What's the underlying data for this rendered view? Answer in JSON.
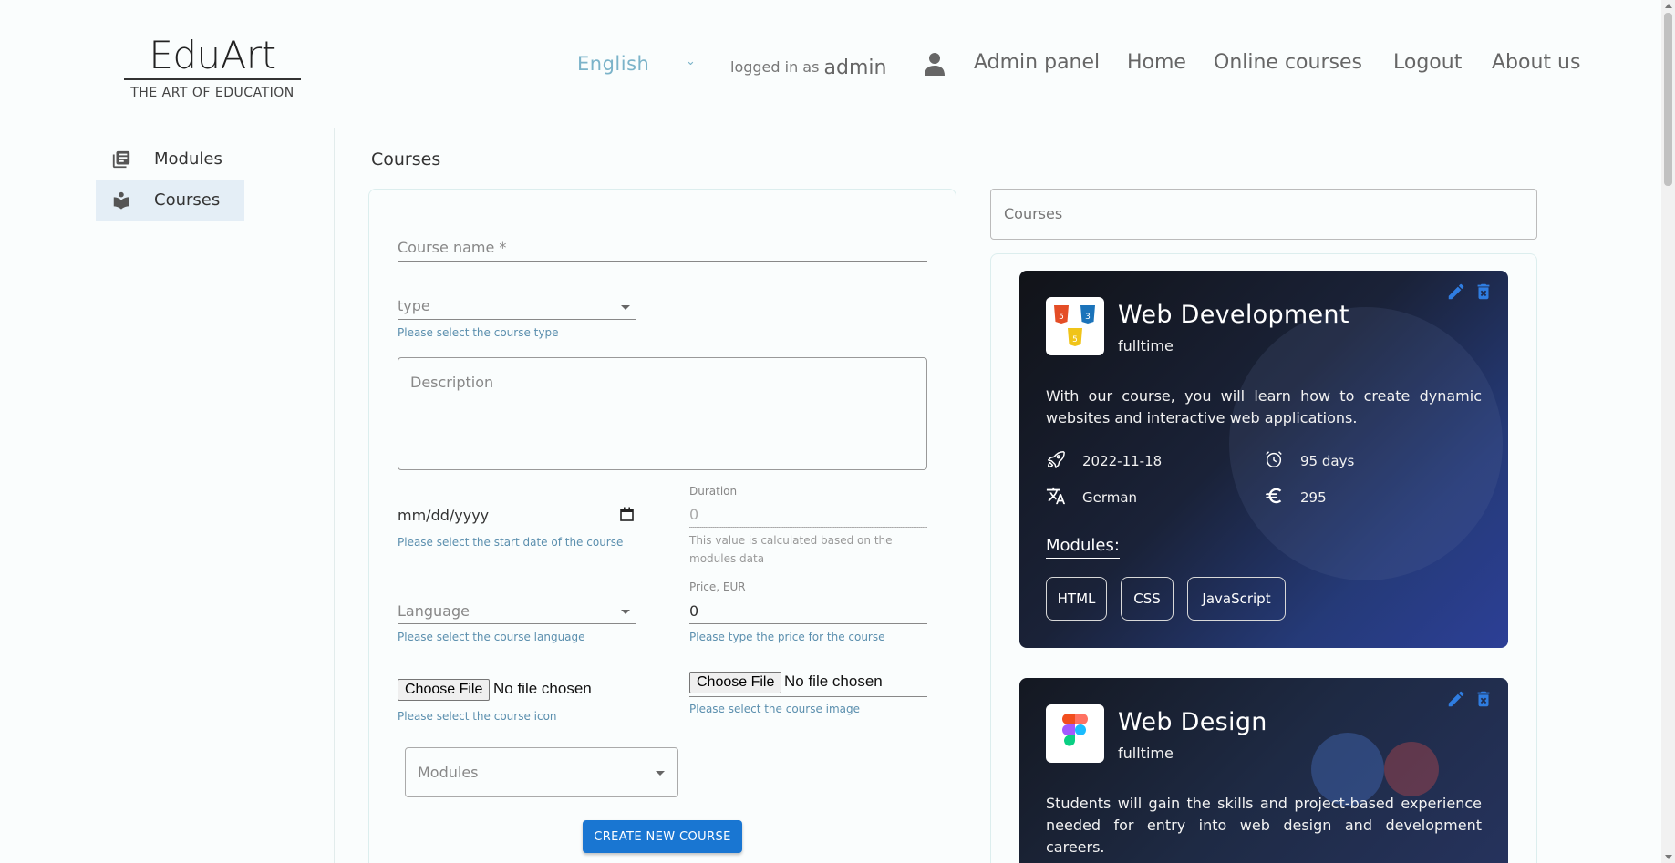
{
  "logo": {
    "title": "EduArt",
    "subtitle": "THE ART OF EDUCATION"
  },
  "header": {
    "language": "English",
    "logged_prefix": "logged in as",
    "username": "admin",
    "nav": [
      "Admin panel",
      "Home",
      "Online courses",
      "Logout",
      "About us"
    ]
  },
  "sidebar": {
    "items": [
      {
        "label": "Modules",
        "icon": "library-books-icon",
        "active": false
      },
      {
        "label": "Courses",
        "icon": "local-library-icon",
        "active": true
      }
    ]
  },
  "page": {
    "title": "Courses"
  },
  "form": {
    "course_name_label": "Course name *",
    "type_label": "type",
    "type_helper": "Please select the course type",
    "description_placeholder": "Description",
    "date_placeholder": "mm/dd/yyyy",
    "date_helper": "Please select the start date of the course",
    "duration_label": "Duration",
    "duration_value": "0",
    "duration_helper_1": "This value is calculated based on the",
    "duration_helper_2": "modules data",
    "language_label": "Language",
    "language_helper": "Please select the course language",
    "price_label": "Price, EUR",
    "price_value": "0",
    "price_helper": "Please type the price for the course",
    "choose_file": "Choose File",
    "no_file": "No file chosen",
    "icon_helper": "Please select the course icon",
    "image_helper": "Please select the course image",
    "modules_label": "Modules",
    "create_button": "CREATE NEW COURSE"
  },
  "search": {
    "placeholder": "Courses"
  },
  "courses": [
    {
      "title": "Web Development",
      "type": "fulltime",
      "description": "With our course, you will learn how to create dynamic websites and interactive web applications.",
      "start_date": "2022-11-18",
      "duration": "95 days",
      "language": "German",
      "price": "295",
      "modules_heading": "Modules:",
      "modules": [
        "HTML",
        "CSS",
        "JavaScript"
      ]
    },
    {
      "title": "Web Design",
      "type": "fulltime",
      "description": "Students will gain the skills and project-based experience needed for entry into web design and development careers."
    }
  ],
  "colors": {
    "accent": "#1976d2",
    "helper": "#5b8fae",
    "language": "#7bb3c9"
  }
}
